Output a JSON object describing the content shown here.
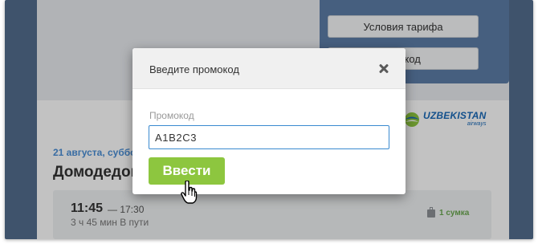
{
  "background": {
    "tariff_panel": {
      "conditions_label": "Условия тарифа",
      "promo_label_visible": "омокод"
    },
    "airline_logo": {
      "name": "UZBEKISTAN",
      "sub": "airways"
    },
    "flight": {
      "date": "21 августа, суббо",
      "route": "Домодедово",
      "departure_time": "11:45",
      "arrival_time": "— 17:30",
      "duration": "3 ч 45 мин В пути",
      "baggage": "1 сумка"
    }
  },
  "modal": {
    "title": "Введите промокод",
    "field_label": "Промокод",
    "input_value": "A1B2C3",
    "submit_label": "Ввести"
  },
  "colors": {
    "frame": "#546d8f",
    "accent_green": "#8dc63f",
    "link_blue": "#4a8fd6",
    "input_focus": "#3a8ad0"
  }
}
